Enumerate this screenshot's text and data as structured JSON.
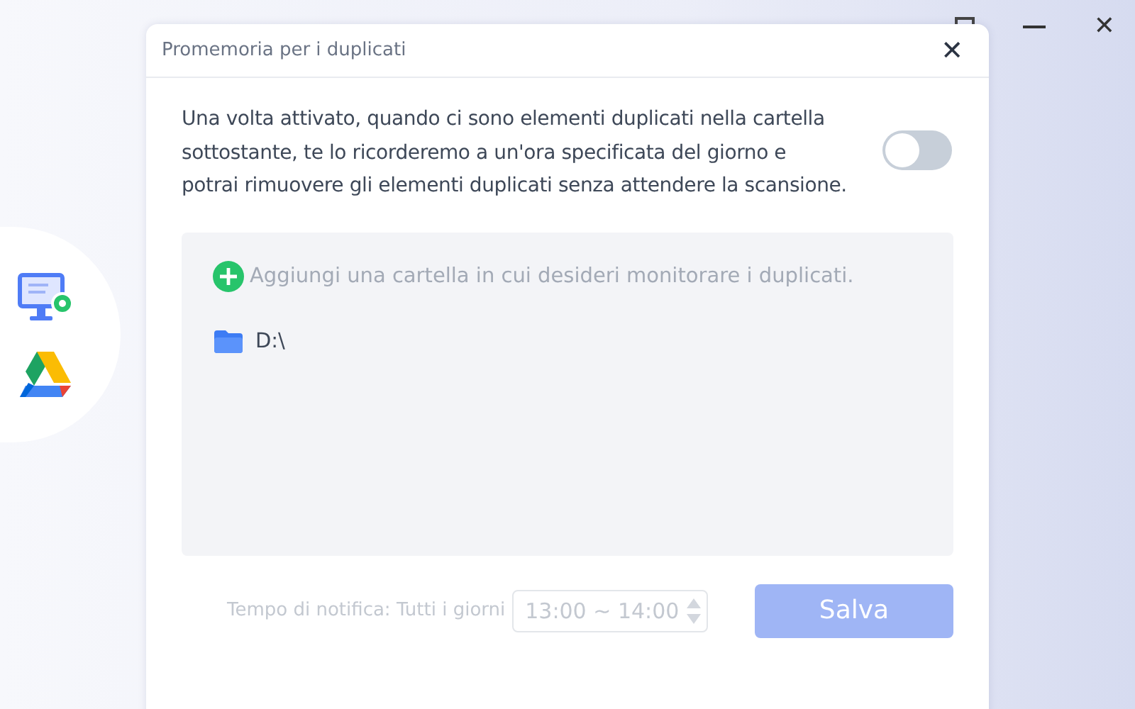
{
  "dialog": {
    "title": "Promemoria per i duplicati",
    "close": "✕"
  },
  "reminder": {
    "description": "Una volta attivato, quando ci sono elementi duplicati nella cartella sottostante, te lo ricorderemo a un'ora specificata del giorno e potrai rimuovere gli elementi duplicati senza attendere la scansione.",
    "on": false
  },
  "folders": {
    "add_label": "Aggiungi una cartella in cui desideri monitorare i duplicati.",
    "items": [
      {
        "name": "D:\\"
      }
    ]
  },
  "footer": {
    "label": "Tempo di notifica: Tutti i giorni",
    "time": "13:00 ~ 14:00",
    "save": "Salva",
    "disabled": true
  },
  "background": {
    "close": "✕"
  }
}
